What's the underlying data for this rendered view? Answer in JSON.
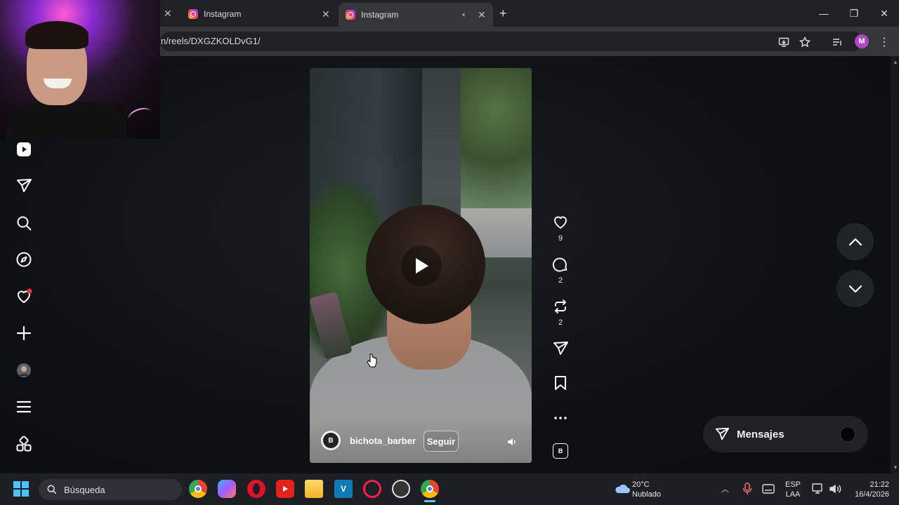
{
  "browser": {
    "tabs": [
      {
        "title": "Instagram",
        "active": false
      },
      {
        "title": "Instagram",
        "active": true
      }
    ],
    "new_tab_icon": "plus-icon",
    "url": "n/reels/DXGZKOLDvG1/",
    "profile_initial": "M"
  },
  "sidebar": {
    "items": [
      {
        "name": "reels",
        "icon": "reels-icon"
      },
      {
        "name": "messages",
        "icon": "send-icon"
      },
      {
        "name": "search",
        "icon": "search-icon"
      },
      {
        "name": "explore",
        "icon": "compass-icon"
      },
      {
        "name": "notifications",
        "icon": "heart-icon",
        "has_badge": true
      },
      {
        "name": "create",
        "icon": "plus-icon"
      },
      {
        "name": "profile",
        "icon": "avatar"
      },
      {
        "name": "more",
        "icon": "menu-icon"
      },
      {
        "name": "also-from-meta",
        "icon": "grid-icon"
      }
    ]
  },
  "reel": {
    "username": "bichota_barber",
    "follow_label": "Seguir",
    "avatar_text": "B",
    "actions": {
      "likes": "9",
      "comments": "2",
      "reposts": "2"
    }
  },
  "messages_pill": {
    "label": "Mensajes"
  },
  "taskbar": {
    "search_placeholder": "Búsqueda",
    "weather": {
      "temp": "20°C",
      "condition": "Nublado"
    },
    "language": {
      "line1": "ESP",
      "line2": "LAA"
    },
    "clock": {
      "time": "21:22",
      "date": "16/4/2026"
    }
  },
  "colors": {
    "accent_badge": "#ff3040",
    "page_bg": "#0c0f13",
    "profile": "#b045c8"
  }
}
